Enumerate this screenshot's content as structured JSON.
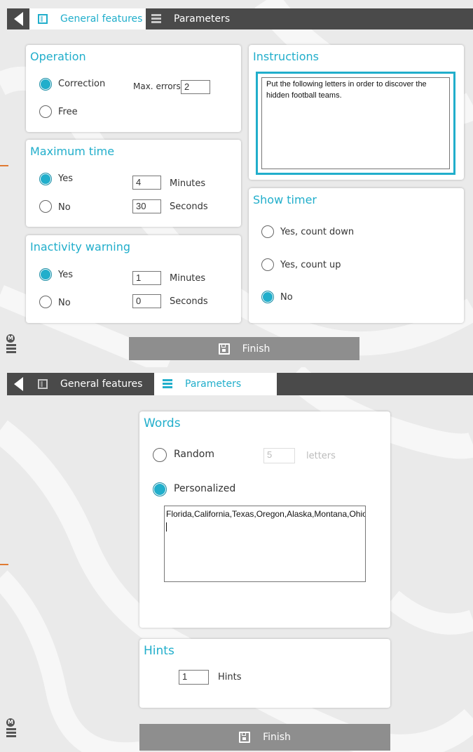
{
  "colors": {
    "accent": "#21aecb",
    "topbar": "#4a4a4a",
    "finish_bg": "#8e8e8e",
    "panel_bg": "#eaeaea"
  },
  "screen1": {
    "tabs": [
      {
        "label": "General features",
        "icon": "features-icon",
        "active": true
      },
      {
        "label": "Parameters",
        "icon": "list-icon",
        "active": false
      }
    ],
    "operation": {
      "title": "Operation",
      "options": [
        {
          "label": "Correction",
          "selected": true
        },
        {
          "label": "Free",
          "selected": false
        }
      ],
      "max_errors_label": "Max. errors",
      "max_errors_value": "2"
    },
    "maximum_time": {
      "title": "Maximum time",
      "options": [
        {
          "label": "Yes",
          "selected": true
        },
        {
          "label": "No",
          "selected": false
        }
      ],
      "minutes_value": "4",
      "minutes_label": "Minutes",
      "seconds_value": "30",
      "seconds_label": "Seconds"
    },
    "inactivity_warning": {
      "title": "Inactivity warning",
      "options": [
        {
          "label": "Yes",
          "selected": true
        },
        {
          "label": "No",
          "selected": false
        }
      ],
      "minutes_value": "1",
      "minutes_label": "Minutes",
      "seconds_value": "0",
      "seconds_label": "Seconds"
    },
    "instructions": {
      "title": "Instructions",
      "text": "Put the following letters in order to discover the hidden football teams."
    },
    "show_timer": {
      "title": "Show timer",
      "options": [
        {
          "label": "Yes, count down",
          "selected": false
        },
        {
          "label": "Yes, count up",
          "selected": false
        },
        {
          "label": "No",
          "selected": true
        }
      ]
    },
    "finish_label": "Finish"
  },
  "screen2": {
    "tabs": [
      {
        "label": "General features",
        "icon": "features-icon",
        "active": false
      },
      {
        "label": "Parameters",
        "icon": "list-icon",
        "active": true
      }
    ],
    "words": {
      "title": "Words",
      "random_label": "Random",
      "random_selected": false,
      "letters_value": "5",
      "letters_label": "letters",
      "personalized_label": "Personalized",
      "personalized_selected": true,
      "words_text": "Florida,California,Texas,Oregon,Alaska,Montana,Ohio,Colorado,Arizona,Georgia"
    },
    "hints": {
      "title": "Hints",
      "value": "1",
      "label": "Hints"
    },
    "finish_label": "Finish"
  },
  "brand_letter": "M"
}
